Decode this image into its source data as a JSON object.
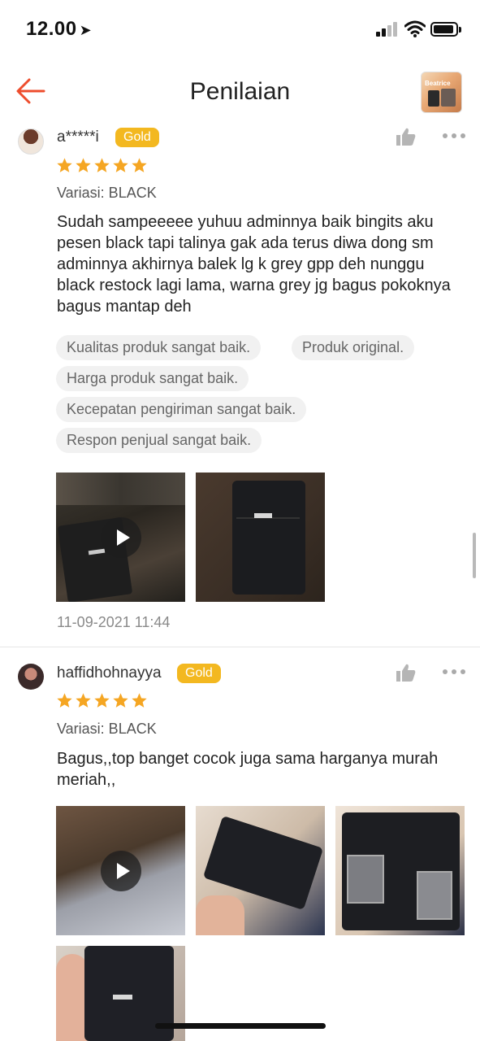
{
  "status_bar": {
    "time": "12.00",
    "location_icon": "location-arrow-icon",
    "signal_icon": "cellular-signal-icon",
    "wifi_icon": "wifi-icon",
    "battery_icon": "battery-icon"
  },
  "header": {
    "title": "Penilaian",
    "back_icon": "back-arrow-icon",
    "accent_color": "#ee4d2d",
    "product_thumb_text": "Beatrice"
  },
  "reviews": [
    {
      "username": "a*****i",
      "badge": "Gold",
      "rating": 5,
      "variant": "Variasi: BLACK",
      "text": "Sudah sampeeeee yuhuu adminnya baik bingits aku pesen black tapi talinya gak ada terus diwa dong sm adminnya akhirnya balek lg k grey gpp deh nunggu black restock lagi lama, warna grey jg bagus pokoknya bagus mantap deh",
      "tags": [
        "Kualitas produk sangat baik.",
        "Produk original.",
        "Harga produk sangat baik.",
        "Kecepatan pengiriman sangat baik.",
        "Respon penjual sangat baik."
      ],
      "media": [
        {
          "type": "video",
          "description": "bag-photo"
        },
        {
          "type": "image",
          "description": "bag-photo"
        }
      ],
      "date": "11-09-2021 11:44"
    },
    {
      "username": "haffidhohnayya",
      "badge": "Gold",
      "rating": 5,
      "variant": "Variasi: BLACK",
      "text": "Bagus,,top banget cocok juga sama harganya murah meriah,,",
      "media": [
        {
          "type": "video",
          "description": "bag-photo"
        },
        {
          "type": "image",
          "description": "bag-photo"
        },
        {
          "type": "image",
          "description": "bag-photo"
        },
        {
          "type": "image",
          "description": "bag-photo"
        }
      ]
    }
  ],
  "colors": {
    "badge": "#f3b820",
    "star": "#f5a623",
    "tag_bg": "#f1f1f1"
  }
}
